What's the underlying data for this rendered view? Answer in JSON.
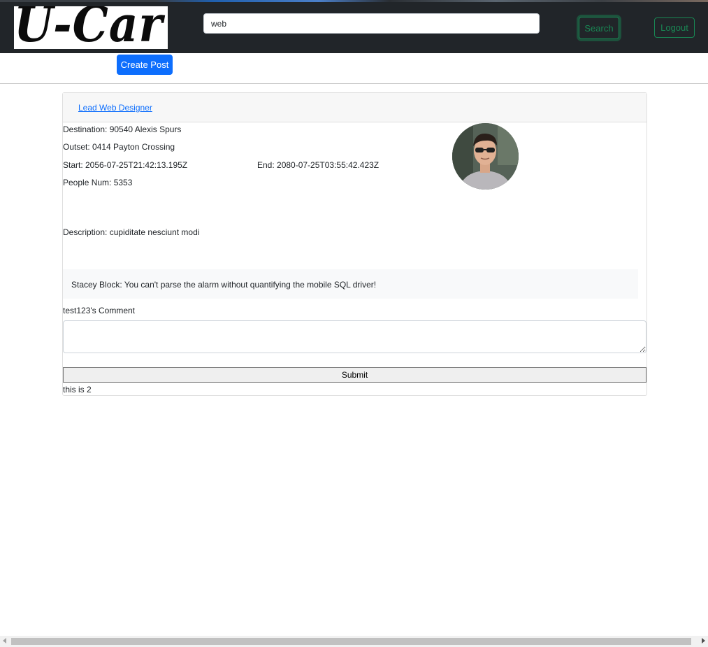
{
  "header": {
    "logo_text": "U-Car",
    "search": {
      "value": "web",
      "placeholder": ""
    },
    "search_label": "Search",
    "logout_label": "Logout"
  },
  "toolbar": {
    "create_post_label": "Create Post"
  },
  "post": {
    "title": "Lead Web Designer",
    "destination": "Destination: 90540 Alexis Spurs",
    "outset": "Outset: 0414 Payton Crossing",
    "start": "Start: 2056-07-25T21:42:13.195Z",
    "end": "End: 2080-07-25T03:55:42.423Z",
    "people": "People Num: 5353",
    "description": "Description: cupiditate nesciunt modi",
    "comments": [
      {
        "text": "Stacey Block: You can't parse the alarm without quantifying the mobile SQL driver!"
      }
    ],
    "comment_form_label": "test123's Comment",
    "comment_value": "",
    "submit_label": "Submit",
    "footer_text": "this is 2"
  },
  "colors": {
    "navbar": "#212529",
    "primary": "#0d6efd",
    "success": "#198754"
  }
}
